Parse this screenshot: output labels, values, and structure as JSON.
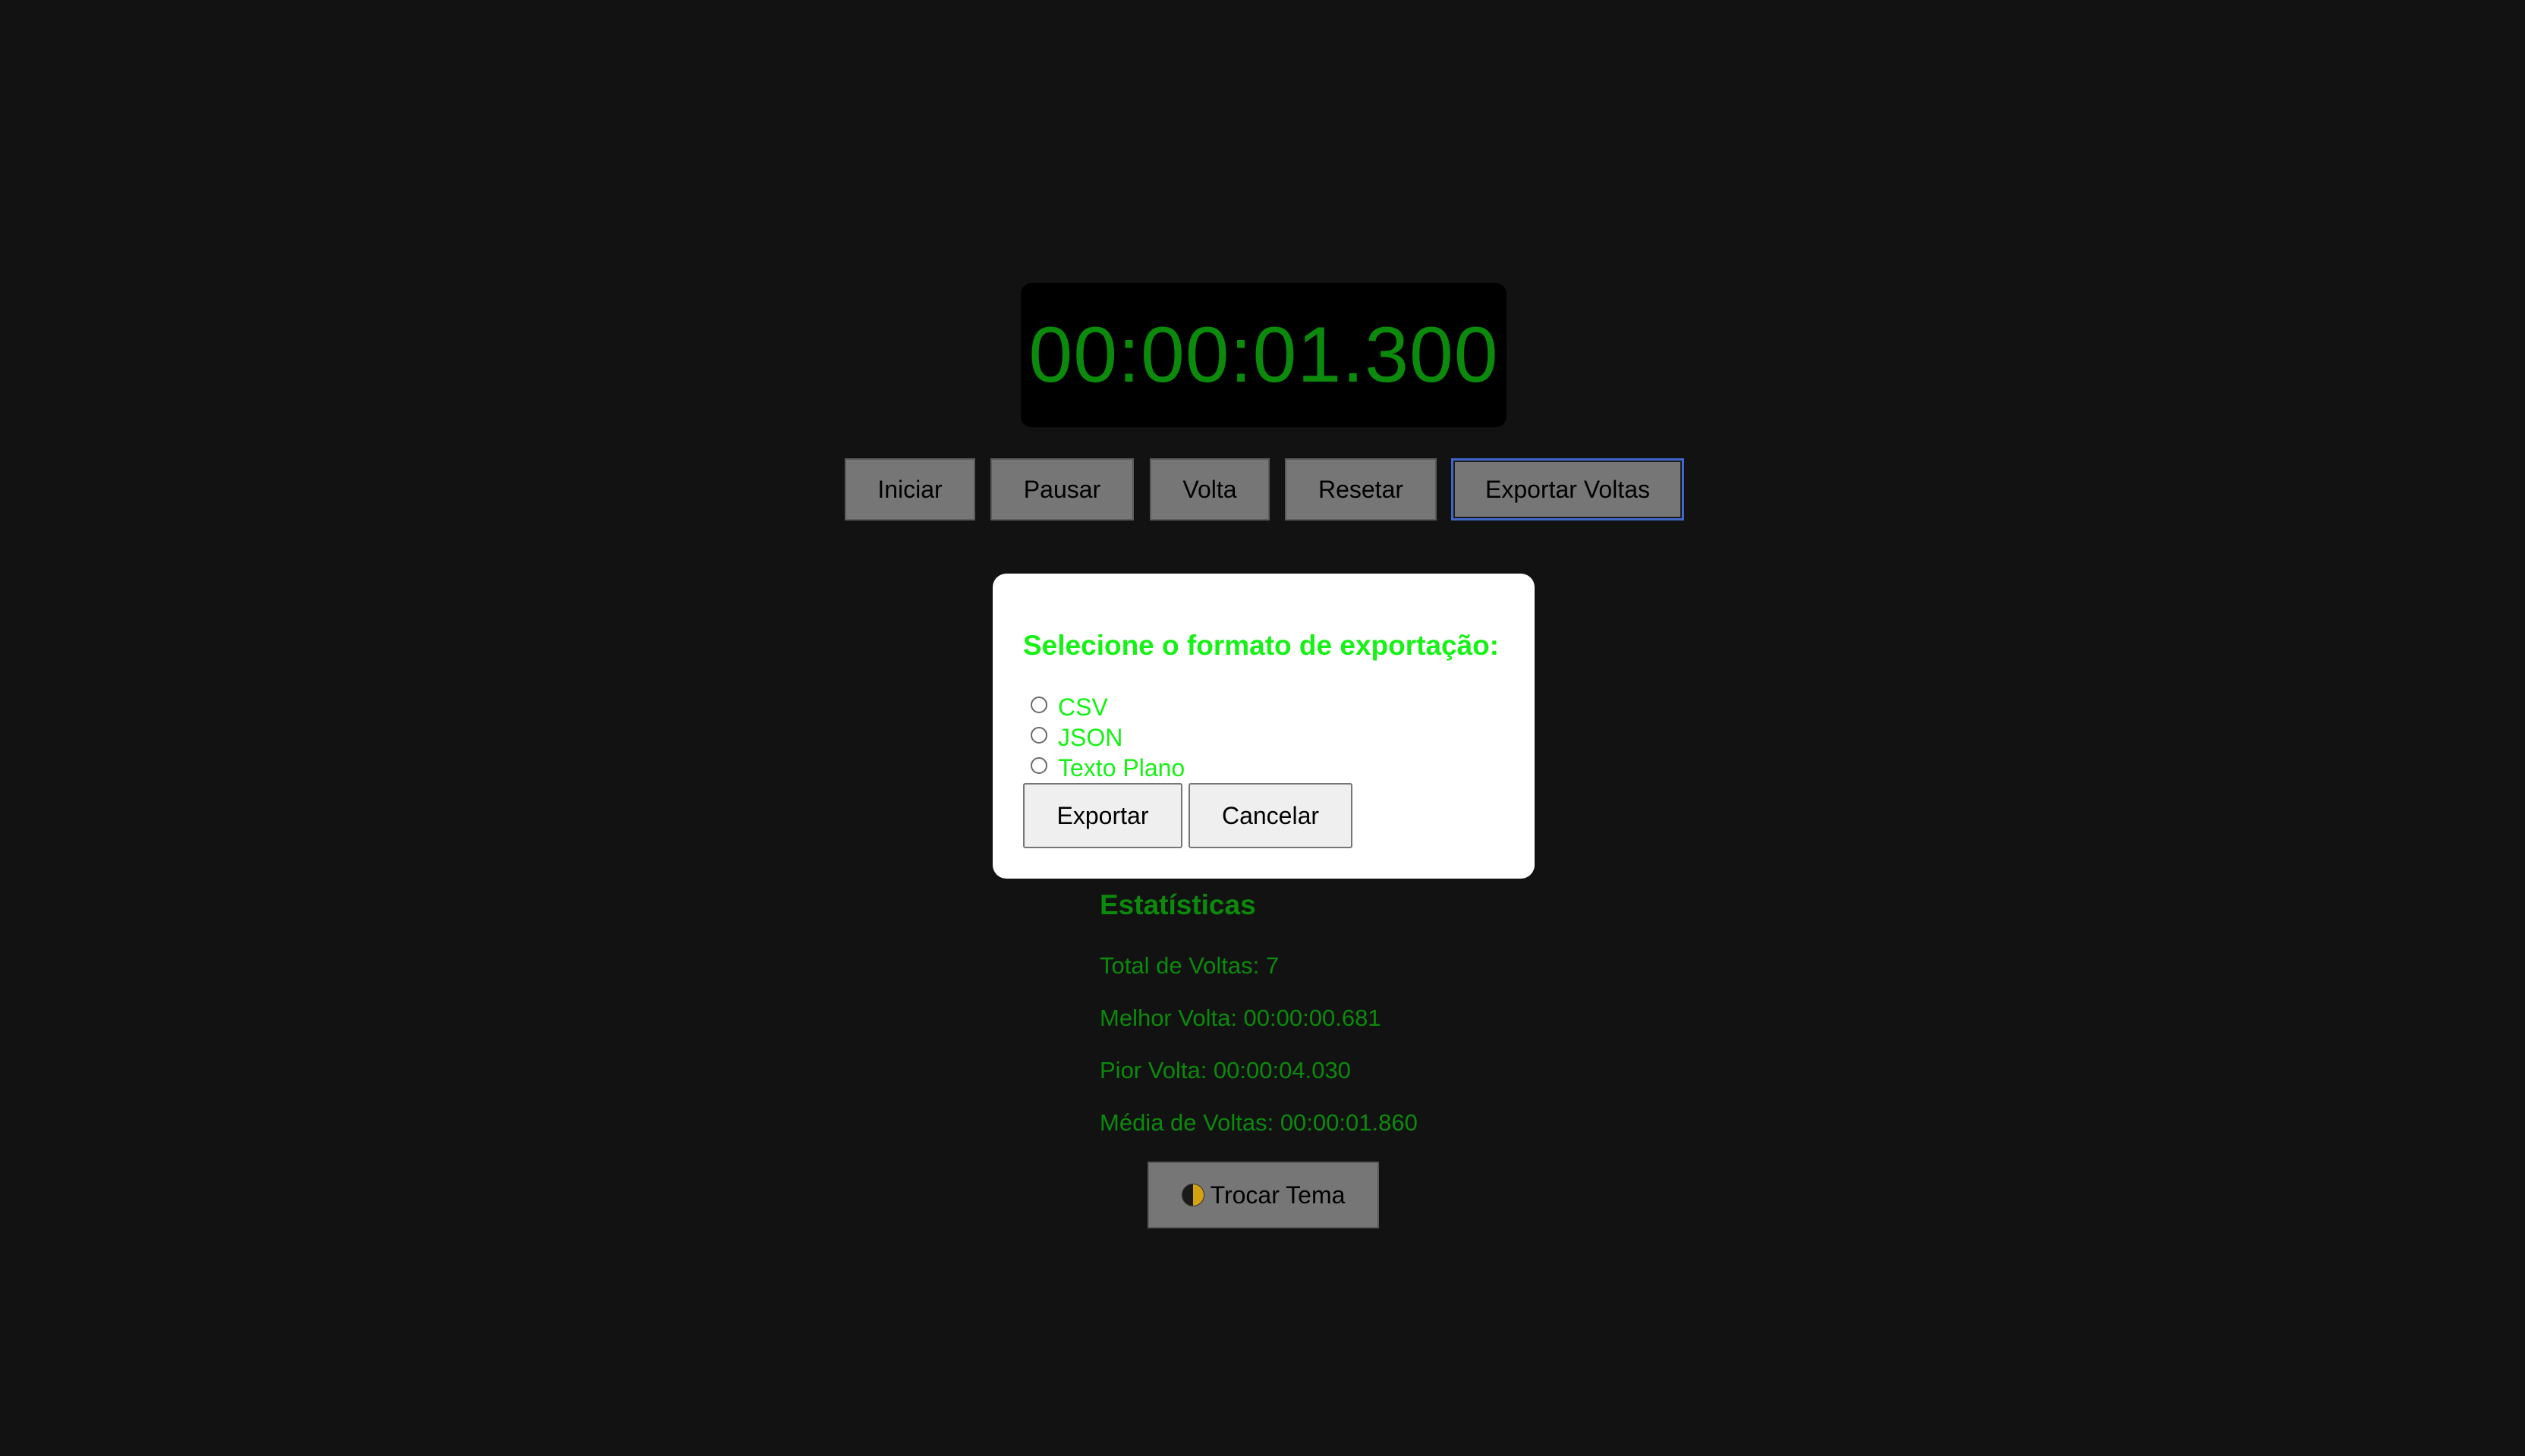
{
  "timer": {
    "display": "00:00:01.300"
  },
  "controls": {
    "start_label": "Iniciar",
    "pause_label": "Pausar",
    "lap_label": "Volta",
    "reset_label": "Resetar",
    "export_label": "Exportar Voltas"
  },
  "export_modal": {
    "title": "Selecione o formato de exportação:",
    "options": [
      "CSV",
      "JSON",
      "Texto Plano"
    ],
    "export_button": "Exportar",
    "cancel_button": "Cancelar"
  },
  "stats": {
    "title": "Estatísticas",
    "total_laps": "Total de Voltas: 7",
    "best_lap": "Melhor Volta: 00:00:00.681",
    "worst_lap": "Pior Volta: 00:00:04.030",
    "average_lap": "Média de Voltas: 00:00:01.860"
  },
  "theme": {
    "toggle_label": "Trocar Tema",
    "icon": "half-moon-icon"
  },
  "colors": {
    "background": "#121212",
    "timer_text": "#0b8a0b",
    "modal_text": "#16f116",
    "button_gray": "#767676",
    "focus_ring": "#3f66c9"
  }
}
